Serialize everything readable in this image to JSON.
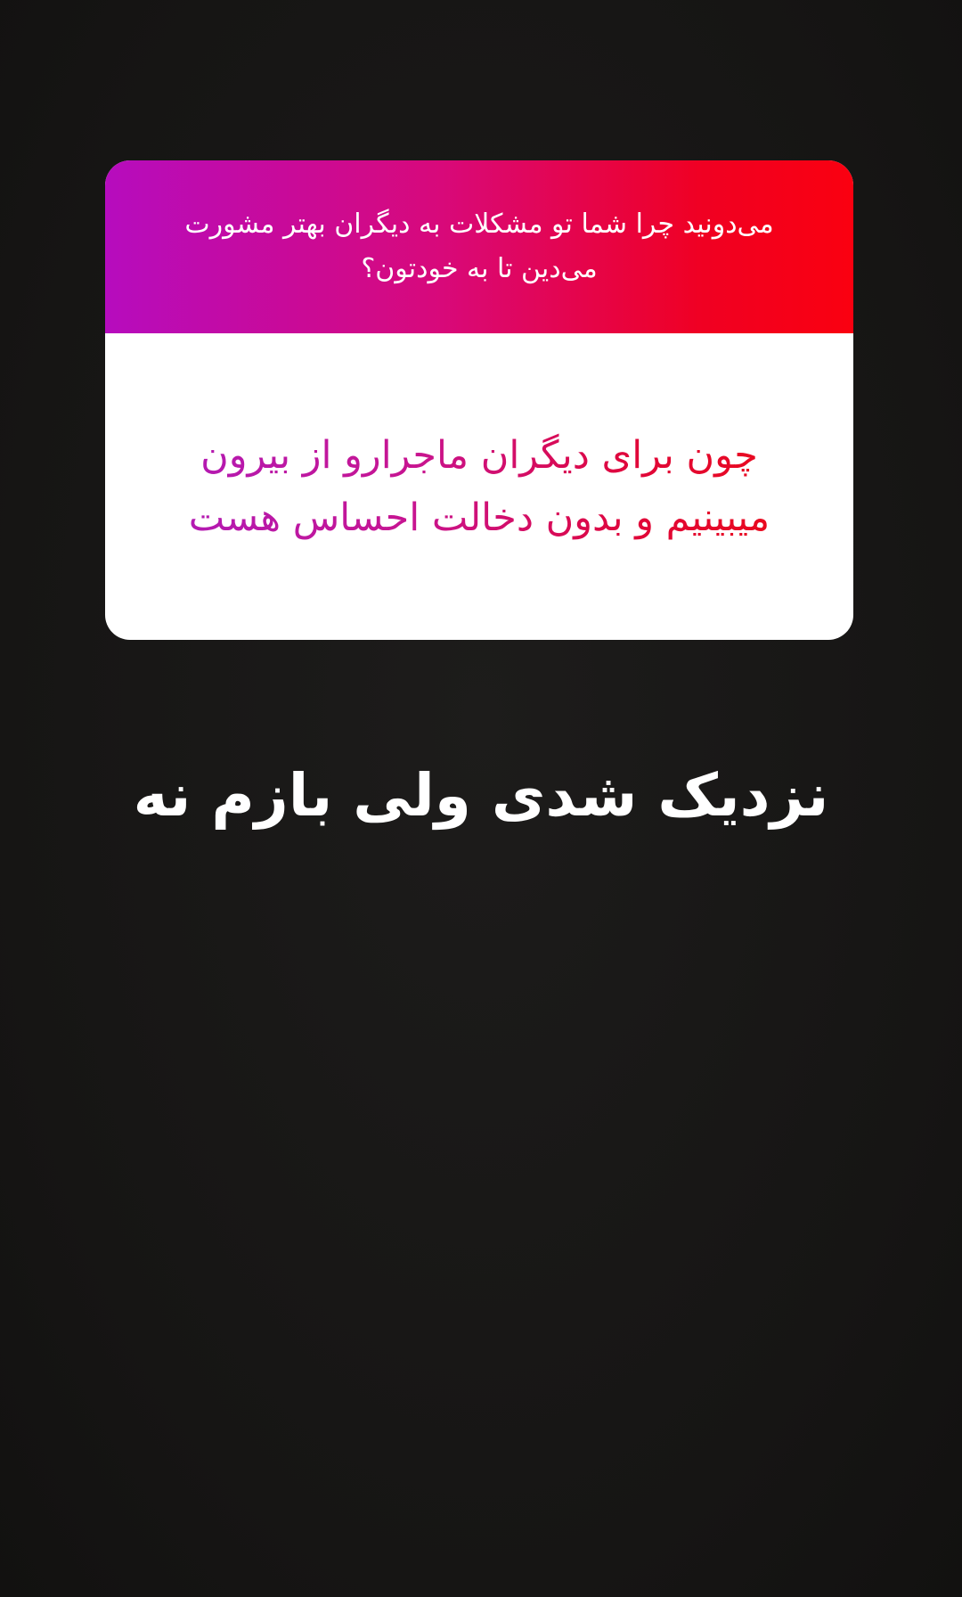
{
  "question_sticker": {
    "question": "می‌دونید چرا شما تو مشکلات به دیگران بهتر مشورت می‌دین تا به خودتون؟",
    "answer": "چون برای دیگران ماجرارو از بیرون میبینیم و بدون دخالت احساس هست",
    "colors": {
      "header_gradient_start": "#b60cbe",
      "header_gradient_end": "#fa0010",
      "answer_gradient_start": "#b21ab4",
      "answer_gradient_end": "#ea0a1c"
    }
  },
  "caption": {
    "text": "نزدیک شدی ولی بازم نه"
  },
  "background_color": "#171615"
}
